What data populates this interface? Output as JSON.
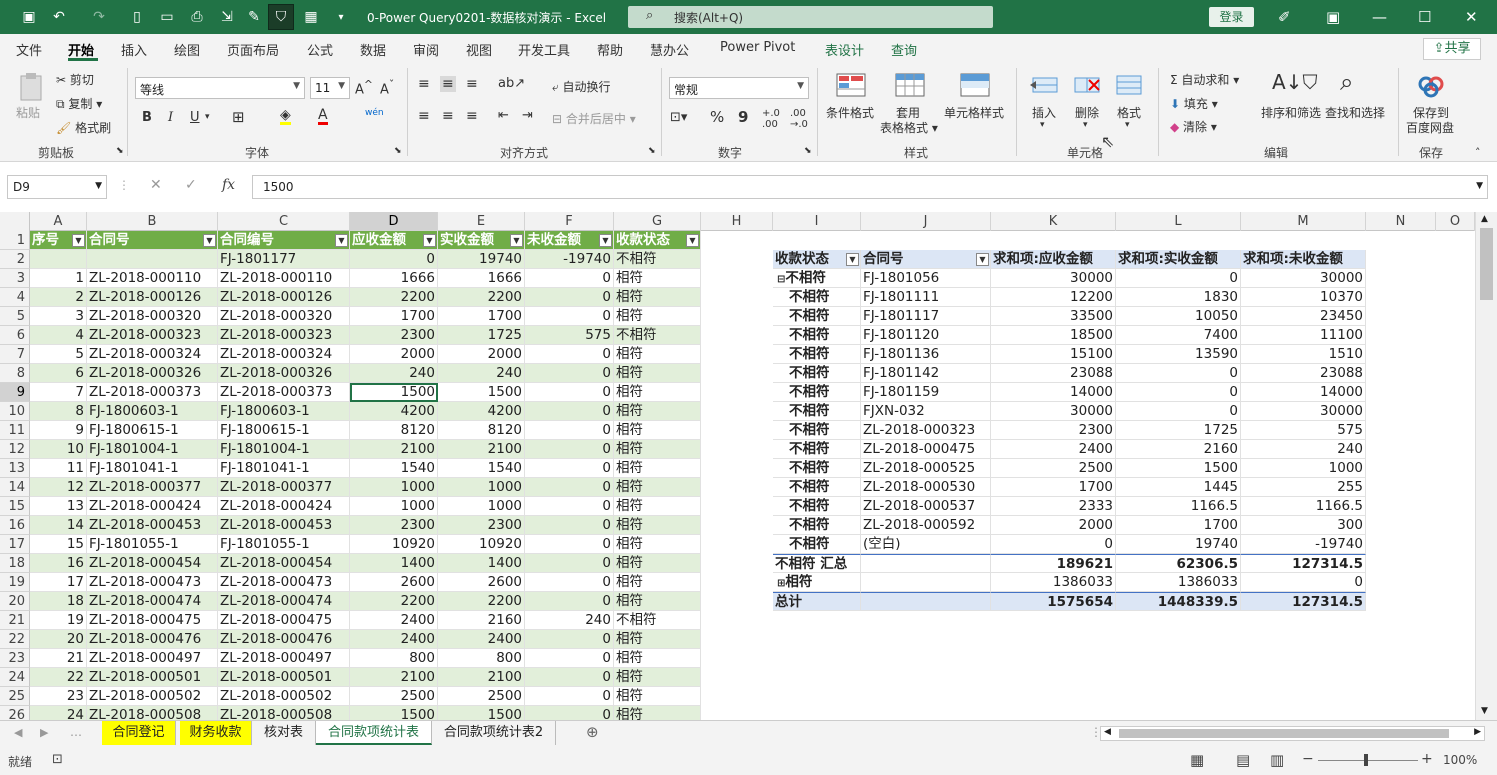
{
  "window": {
    "doc_title": "0-Power Query0201-数据核对演示 - Excel",
    "search_placeholder": "搜索(Alt+Q)",
    "login": "登录"
  },
  "menu": {
    "tabs": [
      "文件",
      "开始",
      "插入",
      "绘图",
      "页面布局",
      "公式",
      "数据",
      "审阅",
      "视图",
      "开发工具",
      "帮助",
      "慧办公",
      "Power Pivot",
      "表设计",
      "查询"
    ],
    "active": "开始",
    "share": "共享"
  },
  "ribbon": {
    "clipboard": {
      "paste": "粘贴",
      "cut": "剪切",
      "copy": "复制",
      "format_painter": "格式刷",
      "label": "剪贴板"
    },
    "font": {
      "name": "等线",
      "size": "11",
      "bold": "B",
      "italic": "I",
      "underline": "U",
      "label": "字体"
    },
    "alignment": {
      "wrap": "自动换行",
      "merge": "合并后居中",
      "label": "对齐方式"
    },
    "number": {
      "format": "常规",
      "label": "数字"
    },
    "styles": {
      "cond": "条件格式",
      "table1": "套用",
      "table2": "表格格式",
      "cell": "单元格样式",
      "label": "样式"
    },
    "cells": {
      "insert": "插入",
      "delete": "删除",
      "format": "格式",
      "label": "单元格"
    },
    "editing": {
      "autosum": "自动求和",
      "fill": "填充",
      "clear": "清除",
      "sort": "排序和筛选",
      "find": "查找和选择",
      "label": "编辑"
    },
    "save": {
      "l1": "保存到",
      "l2": "百度网盘",
      "label": "保存"
    }
  },
  "formula_bar": {
    "namebox": "D9",
    "formula": "1500"
  },
  "columns": [
    "A",
    "B",
    "C",
    "D",
    "E",
    "F",
    "G",
    "H",
    "I",
    "J",
    "K",
    "L",
    "M",
    "N",
    "O"
  ],
  "table": {
    "headers": [
      "序号",
      "合同号",
      "合同编号",
      "应收金额",
      "实收金额",
      "未收金额",
      "收款状态"
    ],
    "rows": [
      [
        "",
        "",
        "FJ-1801177",
        "0",
        "19740",
        "-19740",
        "不相符"
      ],
      [
        "1",
        "ZL-2018-000110",
        "ZL-2018-000110",
        "1666",
        "1666",
        "0",
        "相符"
      ],
      [
        "2",
        "ZL-2018-000126",
        "ZL-2018-000126",
        "2200",
        "2200",
        "0",
        "相符"
      ],
      [
        "3",
        "ZL-2018-000320",
        "ZL-2018-000320",
        "1700",
        "1700",
        "0",
        "相符"
      ],
      [
        "4",
        "ZL-2018-000323",
        "ZL-2018-000323",
        "2300",
        "1725",
        "575",
        "不相符"
      ],
      [
        "5",
        "ZL-2018-000324",
        "ZL-2018-000324",
        "2000",
        "2000",
        "0",
        "相符"
      ],
      [
        "6",
        "ZL-2018-000326",
        "ZL-2018-000326",
        "240",
        "240",
        "0",
        "相符"
      ],
      [
        "7",
        "ZL-2018-000373",
        "ZL-2018-000373",
        "1500",
        "1500",
        "0",
        "相符"
      ],
      [
        "8",
        "FJ-1800603-1",
        "FJ-1800603-1",
        "4200",
        "4200",
        "0",
        "相符"
      ],
      [
        "9",
        "FJ-1800615-1",
        "FJ-1800615-1",
        "8120",
        "8120",
        "0",
        "相符"
      ],
      [
        "10",
        "FJ-1801004-1",
        "FJ-1801004-1",
        "2100",
        "2100",
        "0",
        "相符"
      ],
      [
        "11",
        "FJ-1801041-1",
        "FJ-1801041-1",
        "1540",
        "1540",
        "0",
        "相符"
      ],
      [
        "12",
        "ZL-2018-000377",
        "ZL-2018-000377",
        "1000",
        "1000",
        "0",
        "相符"
      ],
      [
        "13",
        "ZL-2018-000424",
        "ZL-2018-000424",
        "1000",
        "1000",
        "0",
        "相符"
      ],
      [
        "14",
        "ZL-2018-000453",
        "ZL-2018-000453",
        "2300",
        "2300",
        "0",
        "相符"
      ],
      [
        "15",
        "FJ-1801055-1",
        "FJ-1801055-1",
        "10920",
        "10920",
        "0",
        "相符"
      ],
      [
        "16",
        "ZL-2018-000454",
        "ZL-2018-000454",
        "1400",
        "1400",
        "0",
        "相符"
      ],
      [
        "17",
        "ZL-2018-000473",
        "ZL-2018-000473",
        "2600",
        "2600",
        "0",
        "相符"
      ],
      [
        "18",
        "ZL-2018-000474",
        "ZL-2018-000474",
        "2200",
        "2200",
        "0",
        "相符"
      ],
      [
        "19",
        "ZL-2018-000475",
        "ZL-2018-000475",
        "2400",
        "2160",
        "240",
        "不相符"
      ],
      [
        "20",
        "ZL-2018-000476",
        "ZL-2018-000476",
        "2400",
        "2400",
        "0",
        "相符"
      ],
      [
        "21",
        "ZL-2018-000497",
        "ZL-2018-000497",
        "800",
        "800",
        "0",
        "相符"
      ],
      [
        "22",
        "ZL-2018-000501",
        "ZL-2018-000501",
        "2100",
        "2100",
        "0",
        "相符"
      ],
      [
        "23",
        "ZL-2018-000502",
        "ZL-2018-000502",
        "2500",
        "2500",
        "0",
        "相符"
      ],
      [
        "24",
        "ZL-2018-000508",
        "ZL-2018-000508",
        "1500",
        "1500",
        "0",
        "相符"
      ]
    ]
  },
  "pivot": {
    "headers": [
      "收款状态",
      "合同号",
      "求和项:应收金额",
      "求和项:实收金额",
      "求和项:未收金额"
    ],
    "group1": "不相符",
    "rows": [
      [
        "不相符",
        "FJ-1801056",
        "30000",
        "0",
        "30000"
      ],
      [
        "不相符",
        "FJ-1801111",
        "12200",
        "1830",
        "10370"
      ],
      [
        "不相符",
        "FJ-1801117",
        "33500",
        "10050",
        "23450"
      ],
      [
        "不相符",
        "FJ-1801120",
        "18500",
        "7400",
        "11100"
      ],
      [
        "不相符",
        "FJ-1801136",
        "15100",
        "13590",
        "1510"
      ],
      [
        "不相符",
        "FJ-1801142",
        "23088",
        "0",
        "23088"
      ],
      [
        "不相符",
        "FJ-1801159",
        "14000",
        "0",
        "14000"
      ],
      [
        "不相符",
        "FJXN-032",
        "30000",
        "0",
        "30000"
      ],
      [
        "不相符",
        "ZL-2018-000323",
        "2300",
        "1725",
        "575"
      ],
      [
        "不相符",
        "ZL-2018-000475",
        "2400",
        "2160",
        "240"
      ],
      [
        "不相符",
        "ZL-2018-000525",
        "2500",
        "1500",
        "1000"
      ],
      [
        "不相符",
        "ZL-2018-000530",
        "1700",
        "1445",
        "255"
      ],
      [
        "不相符",
        "ZL-2018-000537",
        "2333",
        "1166.5",
        "1166.5"
      ],
      [
        "不相符",
        "ZL-2018-000592",
        "2000",
        "1700",
        "300"
      ],
      [
        "不相符",
        "(空白)",
        "0",
        "19740",
        "-19740"
      ]
    ],
    "subtotal": [
      "不相符 汇总",
      "",
      "189621",
      "62306.5",
      "127314.5"
    ],
    "group2": [
      "相符",
      "",
      "1386033",
      "1386033",
      "0"
    ],
    "total": [
      "总计",
      "",
      "1575654",
      "1448339.5",
      "127314.5"
    ]
  },
  "sheets": [
    "合同登记",
    "财务收款",
    "核对表",
    "合同款项统计表",
    "合同款项统计表2"
  ],
  "active_sheet": "合同款项统计表",
  "status": {
    "ready": "就绪",
    "zoom": "100%"
  }
}
